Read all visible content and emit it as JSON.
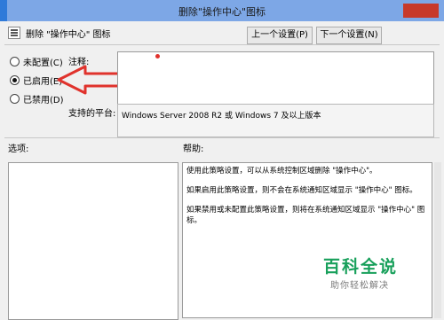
{
  "window": {
    "title": "删除\"操作中心\"图标"
  },
  "header": {
    "title": "删除 \"操作中心\" 图标",
    "prev_label": "上一个设置(P)",
    "next_label": "下一个设置(N)"
  },
  "options": [
    {
      "label": "未配置(C)",
      "selected": false
    },
    {
      "label": "已启用(E)",
      "selected": true
    },
    {
      "label": "已禁用(D)",
      "selected": false
    }
  ],
  "comment": {
    "label": "注释:",
    "value": ""
  },
  "platform": {
    "label": "支持的平台:",
    "value": "Windows Server 2008 R2 或 Windows 7 及以上版本"
  },
  "sections": {
    "options_label": "选项:",
    "help_label": "帮助:"
  },
  "help": {
    "p1": "使用此策略设置，可以从系统控制区域删除 \"操作中心\"。",
    "p2": "如果启用此策略设置，则不会在系统通知区域显示 \"操作中心\" 图标。",
    "p3": "如果禁用或未配置此策略设置，则将在系统通知区域显示 \"操作中心\" 图标。"
  },
  "watermark": {
    "main": "百科全说",
    "sub": "助你轻松解决"
  },
  "colors": {
    "arrow": "#e0322c",
    "watermark": "#18a05b",
    "titlebar": "#7da7e6"
  }
}
